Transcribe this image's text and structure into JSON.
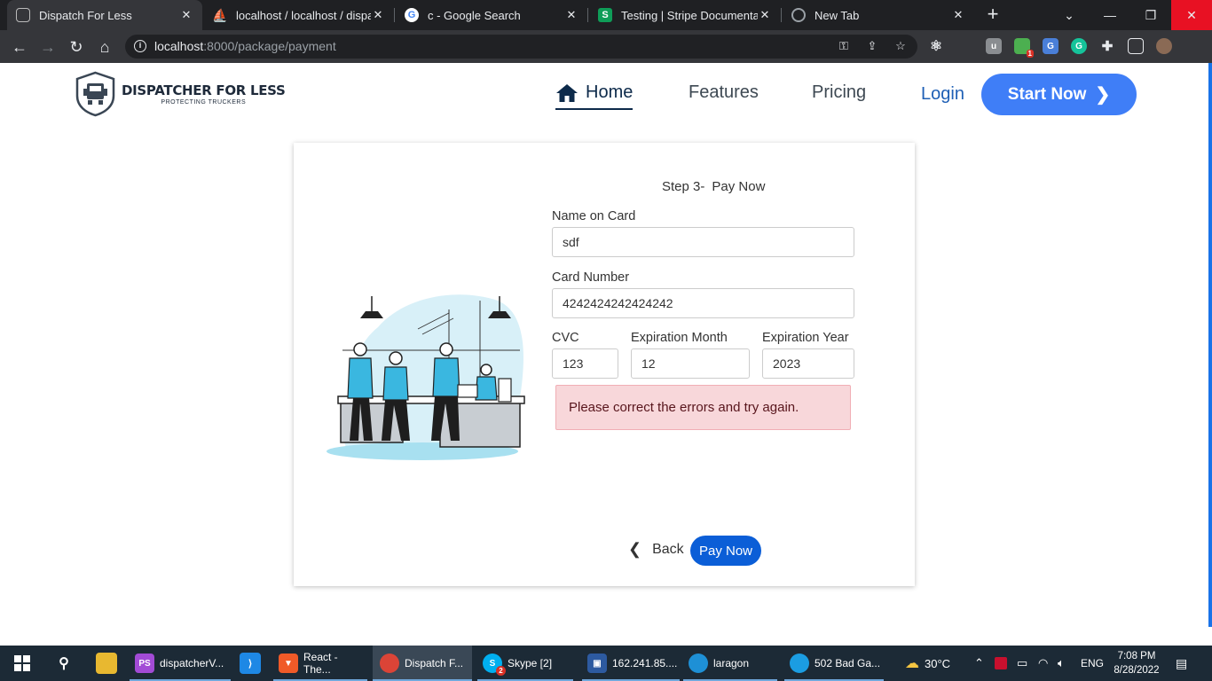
{
  "browser": {
    "tabs": [
      {
        "title": "Dispatch For Less",
        "active": true
      },
      {
        "title": "localhost / localhost / dispatc",
        "active": false
      },
      {
        "title": "c - Google Search",
        "active": false
      },
      {
        "title": "Testing | Stripe Documentatio",
        "active": false
      },
      {
        "title": "New Tab",
        "active": false
      }
    ],
    "url_host": "localhost",
    "url_path": ":8000/package/payment"
  },
  "site": {
    "logo_title": "DISPATCHER FOR LESS",
    "logo_subtitle": "PROTECTING TRUCKERS",
    "nav": {
      "home": "Home",
      "features": "Features",
      "pricing": "Pricing",
      "login": "Login",
      "start": "Start Now"
    }
  },
  "payment": {
    "step_label": "Step 3-",
    "step_title": "Pay Now",
    "name_label": "Name on Card",
    "name_value": "sdf",
    "card_label": "Card Number",
    "card_value": "4242424242424242",
    "cvc_label": "CVC",
    "cvc_value": "123",
    "month_label": "Expiration Month",
    "month_value": "12",
    "year_label": "Expiration Year",
    "year_value": "2023",
    "error": "Please correct the errors and try again.",
    "back": "Back",
    "pay": "Pay Now"
  },
  "taskbar": {
    "apps": [
      {
        "label": "dispatcherV..."
      },
      {
        "label": "React - The..."
      },
      {
        "label": "Dispatch F..."
      },
      {
        "label": "Skype [2]"
      },
      {
        "label": "162.241.85...."
      },
      {
        "label": "laragon"
      },
      {
        "label": "502 Bad Ga..."
      }
    ],
    "weather": "30°C",
    "lang": "ENG",
    "time": "7:08 PM",
    "date": "8/28/2022",
    "skype_badge": "2",
    "ext_badge": "1"
  },
  "colors": {
    "accent": "#3f7ef7",
    "pay_button": "#0b5ed7",
    "alert_bg": "#f8d7da",
    "nav_active": "#0d2a4a"
  }
}
